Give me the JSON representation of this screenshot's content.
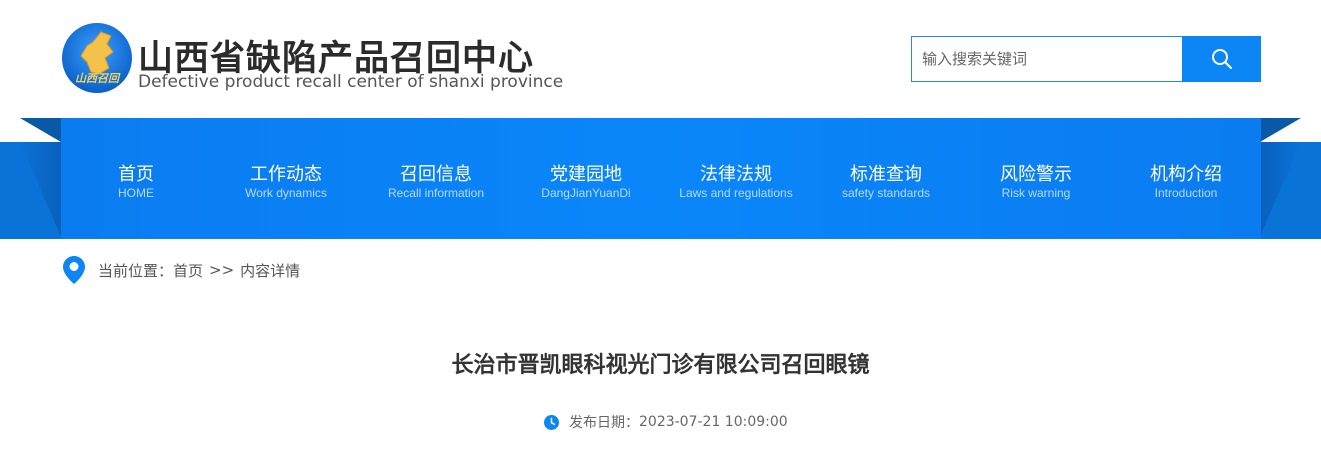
{
  "header": {
    "logo_text": "山西召回",
    "title": "山西省缺陷产品召回中心",
    "subtitle": "Defective product recall center of shanxi province",
    "search": {
      "placeholder": "输入搜索关键词",
      "value": ""
    }
  },
  "nav": {
    "items": [
      {
        "label": "首页",
        "sub": "HOME"
      },
      {
        "label": "工作动态",
        "sub": "Work dynamics"
      },
      {
        "label": "召回信息",
        "sub": "Recall information"
      },
      {
        "label": "党建园地",
        "sub": "DangJianYuanDi"
      },
      {
        "label": "法律法规",
        "sub": "Laws and regulations"
      },
      {
        "label": "标准查询",
        "sub": "safety standards"
      },
      {
        "label": "风险警示",
        "sub": "Risk warning"
      },
      {
        "label": "机构介绍",
        "sub": "Introduction"
      }
    ]
  },
  "breadcrumb": {
    "prefix": "当前位置：",
    "home": "首页",
    "separator": ">>",
    "current": "内容详情"
  },
  "article": {
    "title": "长治市晋凯眼科视光门诊有限公司召回眼镜",
    "date_label": "发布日期：",
    "date": "2023-07-21 10:09:00"
  },
  "colors": {
    "accent": "#0d86f5",
    "nav_bg": "#0a80f5",
    "nav_side": "#0a73d8"
  }
}
